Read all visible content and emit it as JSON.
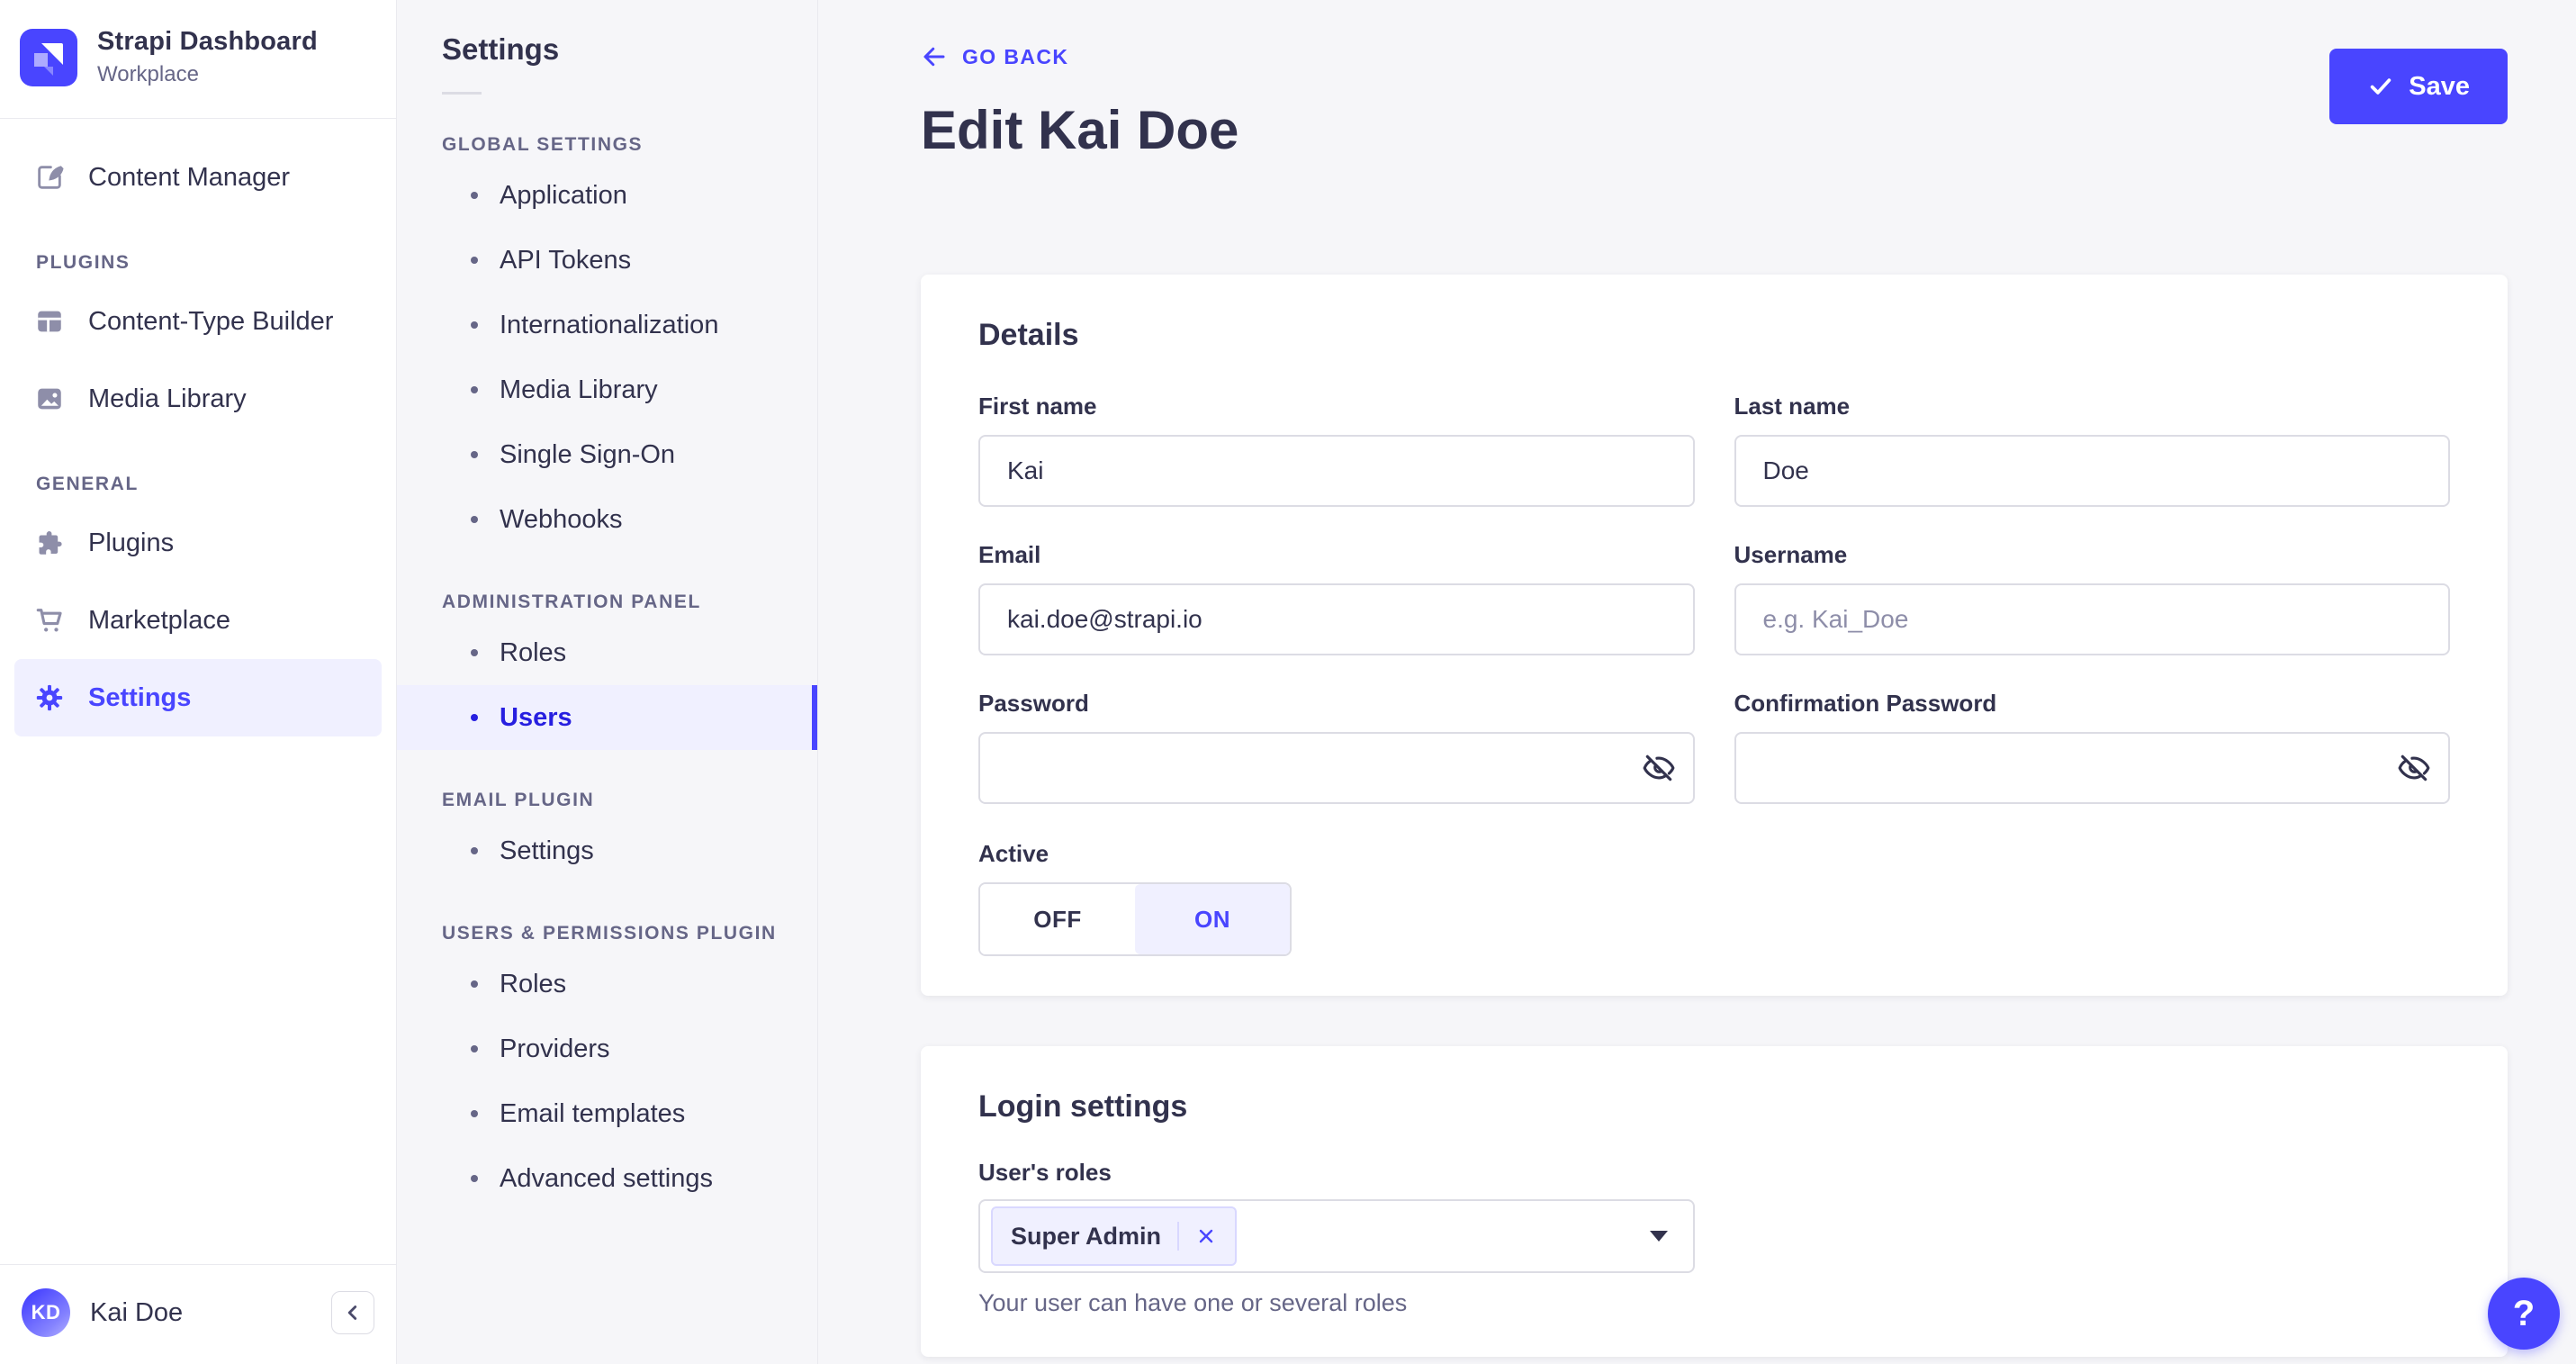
{
  "colors": {
    "primary": "#4945ff",
    "primary_text_active": "#271fe0",
    "primary_light": "#f0f0ff",
    "primary_border": "#d9d8ff",
    "text": "#32324d",
    "muted": "#666687",
    "subtle": "#8e8ea9",
    "border": "#dcdce4",
    "page_bg": "#f6f6f9",
    "panel_bg": "#ffffff"
  },
  "sidebar": {
    "app_title": "Strapi Dashboard",
    "workspace": "Workplace",
    "content_manager": "Content Manager",
    "sections": [
      {
        "label": "PLUGINS",
        "items": [
          "Content-Type Builder",
          "Media Library"
        ]
      },
      {
        "label": "GENERAL",
        "items": [
          "Plugins",
          "Marketplace",
          "Settings"
        ]
      }
    ],
    "active_item": "Settings",
    "user": {
      "initials": "KD",
      "name": "Kai Doe"
    }
  },
  "subnav": {
    "title": "Settings",
    "sections": [
      {
        "label": "GLOBAL SETTINGS",
        "items": [
          "Application",
          "API Tokens",
          "Internationalization",
          "Media Library",
          "Single Sign-On",
          "Webhooks"
        ]
      },
      {
        "label": "ADMINISTRATION PANEL",
        "items": [
          "Roles",
          "Users"
        ]
      },
      {
        "label": "EMAIL PLUGIN",
        "items": [
          "Settings"
        ]
      },
      {
        "label": "USERS & PERMISSIONS PLUGIN",
        "items": [
          "Roles",
          "Providers",
          "Email templates",
          "Advanced settings"
        ]
      }
    ],
    "active_item": "Users"
  },
  "main": {
    "back_label": "GO BACK",
    "title": "Edit Kai Doe",
    "save_label": "Save",
    "details": {
      "heading": "Details",
      "first_name": {
        "label": "First name",
        "value": "Kai"
      },
      "last_name": {
        "label": "Last name",
        "value": "Doe"
      },
      "email": {
        "label": "Email",
        "value": "kai.doe@strapi.io"
      },
      "username": {
        "label": "Username",
        "placeholder": "e.g. Kai_Doe",
        "value": ""
      },
      "password": {
        "label": "Password",
        "value": ""
      },
      "confirmation_password": {
        "label": "Confirmation Password",
        "value": ""
      },
      "active": {
        "label": "Active",
        "off": "OFF",
        "on": "ON",
        "value": "ON"
      }
    },
    "login": {
      "heading": "Login settings",
      "roles_label": "User's roles",
      "selected_role": "Super Admin",
      "hint": "Your user can have one or several roles"
    },
    "help_label": "?"
  }
}
